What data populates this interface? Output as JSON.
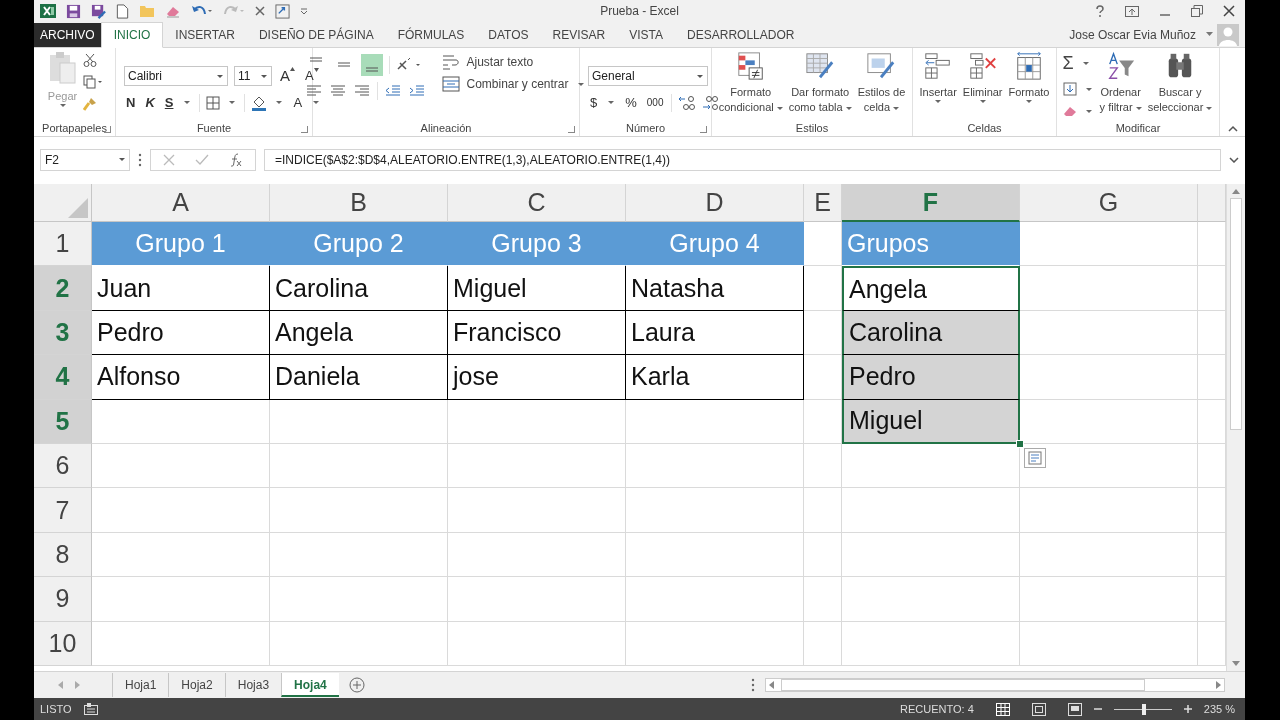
{
  "window": {
    "title": "Prueba - Excel"
  },
  "tabs": [
    {
      "label": "ARCHIVO",
      "kind": "file",
      "selected": false
    },
    {
      "label": "INICIO",
      "kind": "tab",
      "selected": true
    },
    {
      "label": "INSERTAR",
      "kind": "tab",
      "selected": false
    },
    {
      "label": "DISEÑO DE PÁGINA",
      "kind": "tab",
      "selected": false
    },
    {
      "label": "FÓRMULAS",
      "kind": "tab",
      "selected": false
    },
    {
      "label": "DATOS",
      "kind": "tab",
      "selected": false
    },
    {
      "label": "REVISAR",
      "kind": "tab",
      "selected": false
    },
    {
      "label": "VISTA",
      "kind": "tab",
      "selected": false
    },
    {
      "label": "DESARROLLADOR",
      "kind": "tab",
      "selected": false
    }
  ],
  "user": {
    "name": "Jose Oscar Evia Muñoz"
  },
  "ribbon": {
    "clipboard": {
      "name": "Portapapeles",
      "paste": "Pegar"
    },
    "font": {
      "name": "Fuente",
      "font_name": "Calibri",
      "font_size": "11",
      "grow": "A",
      "shrink": "A",
      "bold": "N",
      "italic": "K",
      "underline": "S",
      "font_color": "A"
    },
    "alignment": {
      "name": "Alineación",
      "vertical_align": [
        {
          "selected": false
        },
        {
          "selected": false
        },
        {
          "selected": true
        }
      ],
      "wrap_text": "Ajustar texto",
      "merge_center": "Combinar y centrar"
    },
    "number": {
      "name": "Número",
      "format": "General",
      "currency": "$",
      "percent": "%",
      "thousands": "000"
    },
    "styles": {
      "name": "Estilos",
      "commands": [
        {
          "lines": [
            "Formato",
            "condicional"
          ],
          "kind": "conditional"
        },
        {
          "lines": [
            "Dar formato",
            "como tabla"
          ],
          "kind": "table"
        },
        {
          "lines": [
            "Estilos de",
            "celda"
          ],
          "kind": "cellstyle"
        }
      ]
    },
    "cells": {
      "name": "Celdas",
      "commands": [
        {
          "label": "Insertar",
          "kind": "insert"
        },
        {
          "label": "Eliminar",
          "kind": "delete"
        },
        {
          "label": "Formato",
          "kind": "format"
        }
      ]
    },
    "editing": {
      "name": "Modificar",
      "autosum": "Σ",
      "commands": [
        {
          "lines": [
            "Ordenar",
            "y filtrar"
          ],
          "kind": "sort"
        },
        {
          "lines": [
            "Buscar y",
            "seleccionar"
          ],
          "kind": "find"
        }
      ]
    }
  },
  "formula_bar": {
    "name_box": "F2",
    "formula": "=INDICE($A$2:$D$4,ALEATORIO.ENTRE(1,3),ALEATORIO.ENTRE(1,4))"
  },
  "columns": [
    {
      "label": "A",
      "selected": false
    },
    {
      "label": "B",
      "selected": false
    },
    {
      "label": "C",
      "selected": false
    },
    {
      "label": "D",
      "selected": false
    },
    {
      "label": "E",
      "selected": false
    },
    {
      "label": "F",
      "selected": true
    },
    {
      "label": "G",
      "selected": false
    }
  ],
  "rows": [
    {
      "number": "1",
      "selected": false,
      "cells": [
        {
          "text": "Grupo 1",
          "kind": "header",
          "selected": false
        },
        {
          "text": "Grupo 2",
          "kind": "header",
          "selected": false
        },
        {
          "text": "Grupo 3",
          "kind": "header",
          "selected": false
        },
        {
          "text": "Grupo 4",
          "kind": "header",
          "selected": false
        },
        {
          "kind": "empty",
          "selected": false
        },
        {
          "text": "Grupos",
          "kind": "label",
          "selected": false
        },
        {
          "kind": "empty",
          "selected": false
        }
      ]
    },
    {
      "number": "2",
      "selected": true,
      "cells": [
        {
          "text": "Juan",
          "kind": "data",
          "selected": false
        },
        {
          "text": "Carolina",
          "kind": "data",
          "selected": false
        },
        {
          "text": "Miguel",
          "kind": "data",
          "selected": false
        },
        {
          "text": "Natasha",
          "kind": "data",
          "selected": false
        },
        {
          "kind": "empty",
          "selected": false
        },
        {
          "text": "Angela",
          "kind": "data",
          "selected": true
        },
        {
          "kind": "empty",
          "selected": false
        }
      ]
    },
    {
      "number": "3",
      "selected": true,
      "cells": [
        {
          "text": "Pedro",
          "kind": "data",
          "selected": false
        },
        {
          "text": "Angela",
          "kind": "data",
          "selected": false
        },
        {
          "text": "Francisco",
          "kind": "data",
          "selected": false
        },
        {
          "text": "Laura",
          "kind": "data",
          "selected": false
        },
        {
          "kind": "empty",
          "selected": false
        },
        {
          "text": "Carolina",
          "kind": "data",
          "selected": true
        },
        {
          "kind": "empty",
          "selected": false
        }
      ]
    },
    {
      "number": "4",
      "selected": true,
      "cells": [
        {
          "text": "Alfonso",
          "kind": "data",
          "selected": false
        },
        {
          "text": "Daniela",
          "kind": "data",
          "selected": false
        },
        {
          "text": "jose",
          "kind": "data",
          "selected": false
        },
        {
          "text": "Karla",
          "kind": "data",
          "selected": false
        },
        {
          "kind": "empty",
          "selected": false
        },
        {
          "text": "Pedro",
          "kind": "data",
          "selected": true
        },
        {
          "kind": "empty",
          "selected": false
        }
      ]
    },
    {
      "number": "5",
      "selected": true,
      "cells": [
        {
          "kind": "empty",
          "selected": false
        },
        {
          "kind": "empty",
          "selected": false
        },
        {
          "kind": "empty",
          "selected": false
        },
        {
          "kind": "empty",
          "selected": false
        },
        {
          "kind": "empty",
          "selected": false
        },
        {
          "text": "Miguel",
          "kind": "data",
          "selected": true
        },
        {
          "kind": "empty",
          "selected": false
        }
      ]
    },
    {
      "number": "6",
      "selected": false,
      "cells": [
        {
          "kind": "empty",
          "selected": false
        },
        {
          "kind": "empty",
          "selected": false
        },
        {
          "kind": "empty",
          "selected": false
        },
        {
          "kind": "empty",
          "selected": false
        },
        {
          "kind": "empty",
          "selected": false
        },
        {
          "kind": "empty",
          "selected": false
        },
        {
          "kind": "empty",
          "selected": false
        }
      ]
    },
    {
      "number": "7",
      "selected": false,
      "cells": [
        {
          "kind": "empty",
          "selected": false
        },
        {
          "kind": "empty",
          "selected": false
        },
        {
          "kind": "empty",
          "selected": false
        },
        {
          "kind": "empty",
          "selected": false
        },
        {
          "kind": "empty",
          "selected": false
        },
        {
          "kind": "empty",
          "selected": false
        },
        {
          "kind": "empty",
          "selected": false
        }
      ]
    },
    {
      "number": "8",
      "selected": false,
      "cells": [
        {
          "kind": "empty",
          "selected": false
        },
        {
          "kind": "empty",
          "selected": false
        },
        {
          "kind": "empty",
          "selected": false
        },
        {
          "kind": "empty",
          "selected": false
        },
        {
          "kind": "empty",
          "selected": false
        },
        {
          "kind": "empty",
          "selected": false
        },
        {
          "kind": "empty",
          "selected": false
        }
      ]
    },
    {
      "number": "9",
      "selected": false,
      "cells": [
        {
          "kind": "empty",
          "selected": false
        },
        {
          "kind": "empty",
          "selected": false
        },
        {
          "kind": "empty",
          "selected": false
        },
        {
          "kind": "empty",
          "selected": false
        },
        {
          "kind": "empty",
          "selected": false
        },
        {
          "kind": "empty",
          "selected": false
        },
        {
          "kind": "empty",
          "selected": false
        }
      ]
    },
    {
      "number": "10",
      "selected": false,
      "cells": [
        {
          "kind": "empty",
          "selected": false
        },
        {
          "kind": "empty",
          "selected": false
        },
        {
          "kind": "empty",
          "selected": false
        },
        {
          "kind": "empty",
          "selected": false
        },
        {
          "kind": "empty",
          "selected": false
        },
        {
          "kind": "empty",
          "selected": false
        },
        {
          "kind": "empty",
          "selected": false
        }
      ]
    }
  ],
  "sheets": [
    {
      "label": "Hoja1",
      "selected": false
    },
    {
      "label": "Hoja2",
      "selected": false
    },
    {
      "label": "Hoja3",
      "selected": false
    },
    {
      "label": "Hoja4",
      "selected": true
    }
  ],
  "status_bar": {
    "mode": "LISTO",
    "count": "RECUENTO: 4",
    "zoom": "235 %",
    "zoom_slider": {
      "level": 0.52
    }
  }
}
